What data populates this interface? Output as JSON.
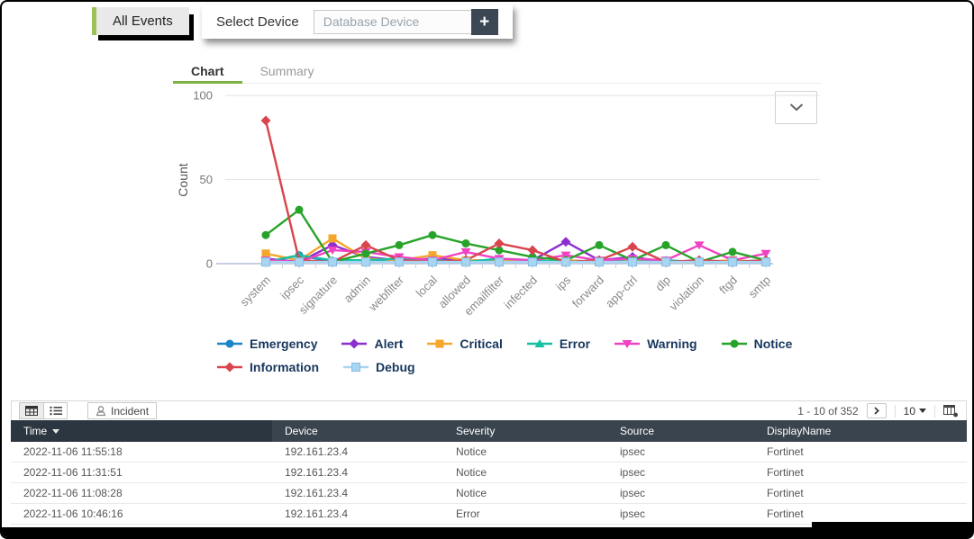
{
  "top_bar": {
    "all_events_tab": "All Events",
    "select_device_label": "Select Device",
    "device_input_placeholder": "Database Device",
    "add_device_button": "+"
  },
  "chart_panel": {
    "tabs": [
      {
        "label": "Chart",
        "active": true
      },
      {
        "label": "Summary",
        "active": false
      }
    ]
  },
  "icons": {
    "chart": [
      "chevron-down-icon"
    ],
    "toolbar": [
      "table-view-icon",
      "list-view-icon",
      "incident-stamp-icon",
      "next-page-icon",
      "page-size-caret-icon",
      "column-settings-icon"
    ]
  },
  "chart_data": {
    "type": "line",
    "title": "",
    "xlabel": "",
    "ylabel": "Count",
    "ylim": [
      0,
      100
    ],
    "yticks": [
      0,
      50,
      100
    ],
    "grid": true,
    "legend_position": "bottom",
    "xticklabel_rotation": -45,
    "categories": [
      "system",
      "ipsec",
      "signature",
      "admin",
      "webfilter",
      "local",
      "allowed",
      "emailfilter",
      "infected",
      "ips",
      "forward",
      "app-ctrl",
      "dlp",
      "violation",
      "ftgd",
      "smtp"
    ],
    "series": [
      {
        "name": "Emergency",
        "color": "#1c85c7",
        "marker": "circle",
        "values": [
          1,
          5,
          1,
          2,
          1,
          1,
          1,
          1,
          1,
          2,
          1,
          1,
          1,
          1,
          1,
          1
        ]
      },
      {
        "name": "Alert",
        "color": "#8c2fd0",
        "marker": "diamond",
        "values": [
          3,
          1,
          11,
          4,
          2,
          3,
          2,
          1,
          2,
          13,
          2,
          4,
          1,
          2,
          1,
          2
        ]
      },
      {
        "name": "Critical",
        "color": "#f4a72c",
        "marker": "square",
        "values": [
          6,
          2,
          15,
          3,
          2,
          5,
          2,
          2,
          1,
          2,
          1,
          2,
          1,
          1,
          2,
          1
        ]
      },
      {
        "name": "Error",
        "color": "#16bfa2",
        "marker": "triangle-up",
        "values": [
          1,
          5,
          2,
          2,
          3,
          2,
          1,
          3,
          2,
          1,
          2,
          1,
          2,
          1,
          1,
          2
        ]
      },
      {
        "name": "Warning",
        "color": "#f042c3",
        "marker": "triangle-down",
        "values": [
          2,
          1,
          8,
          7,
          4,
          2,
          7,
          3,
          2,
          5,
          2,
          3,
          2,
          11,
          2,
          6
        ]
      },
      {
        "name": "Notice",
        "color": "#27a329",
        "marker": "circle",
        "values": [
          17,
          32,
          1,
          6,
          11,
          17,
          12,
          8,
          4,
          2,
          11,
          2,
          11,
          1,
          7,
          2
        ]
      },
      {
        "name": "Information",
        "color": "#d8454d",
        "marker": "diamond",
        "values": [
          85,
          2,
          1,
          11,
          2,
          1,
          2,
          12,
          8,
          1,
          2,
          10,
          1,
          2,
          1,
          2
        ]
      },
      {
        "name": "Debug",
        "color": "#a8d6f2",
        "marker": "square",
        "values": [
          1,
          1,
          1,
          1,
          1,
          1,
          1,
          1,
          1,
          1,
          1,
          1,
          1,
          1,
          1,
          1
        ]
      }
    ]
  },
  "table": {
    "toolbar": {
      "incident_button": "Incident",
      "pagination": "1 - 10 of 352",
      "page_size": "10"
    },
    "columns": [
      "Time",
      "Device",
      "Severity",
      "Source",
      "DisplayName"
    ],
    "sort": {
      "column": "Time",
      "direction": "desc"
    },
    "rows": [
      {
        "time": "2022-11-06 11:55:18",
        "device": "192.161.23.4",
        "severity": "Notice",
        "source": "ipsec",
        "display_name": "Fortinet"
      },
      {
        "time": "2022-11-06 11:31:51",
        "device": "192.161.23.4",
        "severity": "Notice",
        "source": "ipsec",
        "display_name": "Fortinet"
      },
      {
        "time": "2022-11-06 11:08:28",
        "device": "192.161.23.4",
        "severity": "Notice",
        "source": "ipsec",
        "display_name": "Fortinet"
      },
      {
        "time": "2022-11-06 10:46:16",
        "device": "192.161.23.4",
        "severity": "Error",
        "source": "ipsec",
        "display_name": "Fortinet"
      }
    ]
  },
  "colors": {
    "accent_green": "#7cb342",
    "tab_strip_green": "#9cc159",
    "table_header_bg": "#3a444e",
    "table_header_sorted_bg": "#2c3640",
    "slate_button": "#3b4752"
  }
}
